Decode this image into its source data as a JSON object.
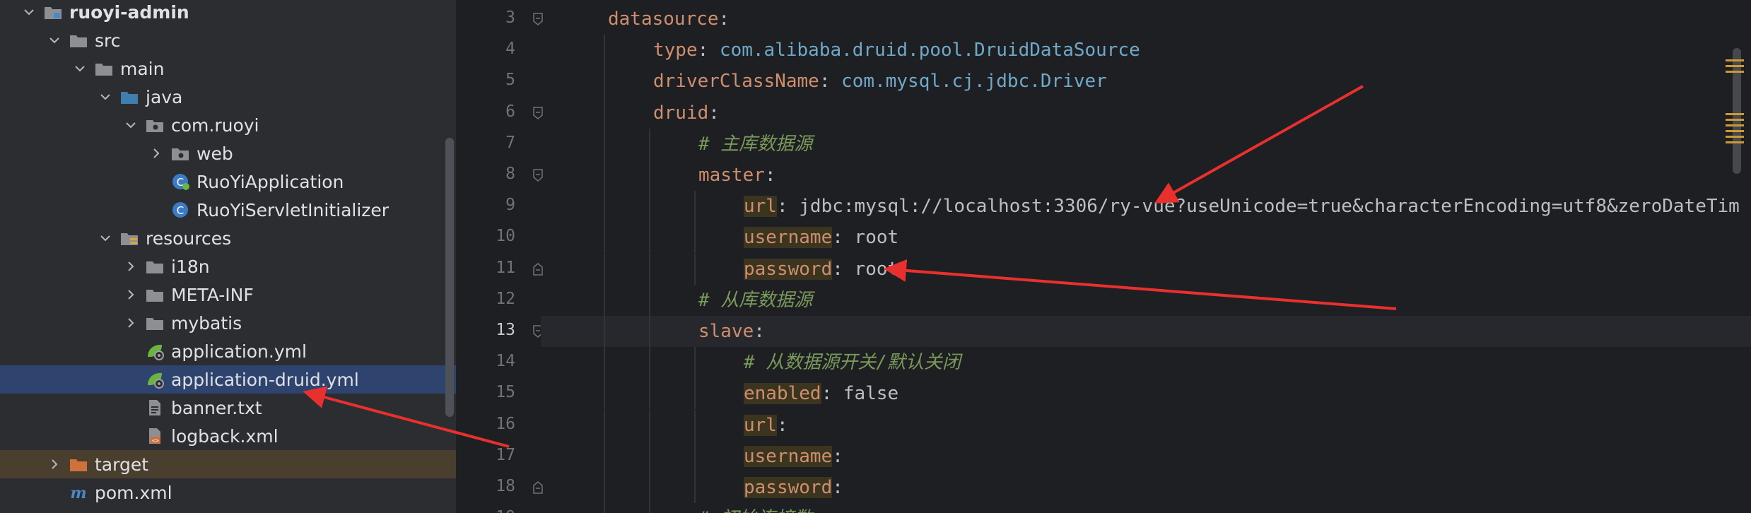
{
  "project_tree": {
    "items": [
      {
        "label": "ruoyi-admin",
        "depth": 1,
        "chevron": "down",
        "icon": "module-folder-icon",
        "bold": true
      },
      {
        "label": "src",
        "depth": 2,
        "chevron": "down",
        "icon": "folder-icon"
      },
      {
        "label": "main",
        "depth": 3,
        "chevron": "down",
        "icon": "folder-icon"
      },
      {
        "label": "java",
        "depth": 4,
        "chevron": "down",
        "icon": "source-folder-icon"
      },
      {
        "label": "com.ruoyi",
        "depth": 5,
        "chevron": "down",
        "icon": "package-icon"
      },
      {
        "label": "web",
        "depth": 6,
        "chevron": "right",
        "icon": "package-icon"
      },
      {
        "label": "RuoYiApplication",
        "depth": 6,
        "chevron": "none",
        "icon": "spring-boot-class-icon"
      },
      {
        "label": "RuoYiServletInitializer",
        "depth": 6,
        "chevron": "none",
        "icon": "class-icon"
      },
      {
        "label": "resources",
        "depth": 4,
        "chevron": "down",
        "icon": "resources-folder-icon"
      },
      {
        "label": "i18n",
        "depth": 5,
        "chevron": "right",
        "icon": "folder-icon"
      },
      {
        "label": "META-INF",
        "depth": 5,
        "chevron": "right",
        "icon": "folder-icon"
      },
      {
        "label": "mybatis",
        "depth": 5,
        "chevron": "right",
        "icon": "folder-icon"
      },
      {
        "label": "application.yml",
        "depth": 5,
        "chevron": "none",
        "icon": "spring-yaml-icon"
      },
      {
        "label": "application-druid.yml",
        "depth": 5,
        "chevron": "none",
        "icon": "spring-yaml-icon",
        "selected": true
      },
      {
        "label": "banner.txt",
        "depth": 5,
        "chevron": "none",
        "icon": "text-file-icon"
      },
      {
        "label": "logback.xml",
        "depth": 5,
        "chevron": "none",
        "icon": "xml-file-icon"
      },
      {
        "label": "target",
        "depth": 2,
        "chevron": "right",
        "icon": "excluded-folder-icon",
        "excluded": true
      },
      {
        "label": "pom.xml",
        "depth": 2,
        "chevron": "none",
        "icon": "maven-icon"
      }
    ]
  },
  "editor": {
    "current_line": "13",
    "lines": [
      {
        "num": "3",
        "indent": 1,
        "tokens": [
          {
            "t": "datasource",
            "c": "k"
          },
          {
            "t": ":",
            "c": "p"
          }
        ],
        "fold": "open"
      },
      {
        "num": "4",
        "indent": 2,
        "tokens": [
          {
            "t": "type",
            "c": "k"
          },
          {
            "t": ": ",
            "c": "p"
          },
          {
            "t": "com.alibaba.druid.pool.DruidDataSource",
            "c": "cls"
          }
        ]
      },
      {
        "num": "5",
        "indent": 2,
        "tokens": [
          {
            "t": "driverClassName",
            "c": "k"
          },
          {
            "t": ": ",
            "c": "p"
          },
          {
            "t": "com.mysql.cj.jdbc.Driver",
            "c": "cls"
          }
        ]
      },
      {
        "num": "6",
        "indent": 2,
        "tokens": [
          {
            "t": "druid",
            "c": "k"
          },
          {
            "t": ":",
            "c": "p"
          }
        ],
        "fold": "open"
      },
      {
        "num": "7",
        "indent": 3,
        "tokens": [
          {
            "t": "# 主库数据源",
            "c": "cm"
          }
        ]
      },
      {
        "num": "8",
        "indent": 3,
        "tokens": [
          {
            "t": "master",
            "c": "k"
          },
          {
            "t": ":",
            "c": "p"
          }
        ],
        "fold": "open"
      },
      {
        "num": "9",
        "indent": 4,
        "tokens": [
          {
            "t": "url",
            "c": "kh"
          },
          {
            "t": ": ",
            "c": "p"
          },
          {
            "t": "jdbc:mysql://localhost:3306/ry-vue?useUnicode=true&characterEncoding=utf8&zeroDateTim",
            "c": "v"
          }
        ]
      },
      {
        "num": "10",
        "indent": 4,
        "tokens": [
          {
            "t": "username",
            "c": "kh"
          },
          {
            "t": ": ",
            "c": "p"
          },
          {
            "t": "root",
            "c": "v"
          }
        ]
      },
      {
        "num": "11",
        "indent": 4,
        "tokens": [
          {
            "t": "password",
            "c": "kh"
          },
          {
            "t": ": ",
            "c": "p"
          },
          {
            "t": "root",
            "c": "v"
          }
        ],
        "fold": "close"
      },
      {
        "num": "12",
        "indent": 3,
        "tokens": [
          {
            "t": "# 从库数据源",
            "c": "cm"
          }
        ]
      },
      {
        "num": "13",
        "indent": 3,
        "tokens": [
          {
            "t": "slave",
            "c": "k"
          },
          {
            "t": ":",
            "c": "p"
          }
        ],
        "fold": "open"
      },
      {
        "num": "14",
        "indent": 4,
        "tokens": [
          {
            "t": "# 从数据源开关/默认关闭",
            "c": "cm"
          }
        ]
      },
      {
        "num": "15",
        "indent": 4,
        "tokens": [
          {
            "t": "enabled",
            "c": "kh"
          },
          {
            "t": ": ",
            "c": "p"
          },
          {
            "t": "false",
            "c": "v"
          }
        ]
      },
      {
        "num": "16",
        "indent": 4,
        "tokens": [
          {
            "t": "url",
            "c": "kh"
          },
          {
            "t": ":",
            "c": "p"
          }
        ]
      },
      {
        "num": "17",
        "indent": 4,
        "tokens": [
          {
            "t": "username",
            "c": "kh"
          },
          {
            "t": ":",
            "c": "p"
          }
        ]
      },
      {
        "num": "18",
        "indent": 4,
        "tokens": [
          {
            "t": "password",
            "c": "kh"
          },
          {
            "t": ":",
            "c": "p"
          }
        ],
        "fold": "close"
      },
      {
        "num": "19",
        "indent": 3,
        "tokens": [
          {
            "t": "# 初始连接数",
            "c": "cm"
          }
        ]
      }
    ]
  },
  "annotations": {
    "arrow_color": "#e8302e",
    "arrows": [
      "arrow-to-application-druid-yml",
      "arrow-to-database-name",
      "arrow-to-password-value"
    ]
  }
}
